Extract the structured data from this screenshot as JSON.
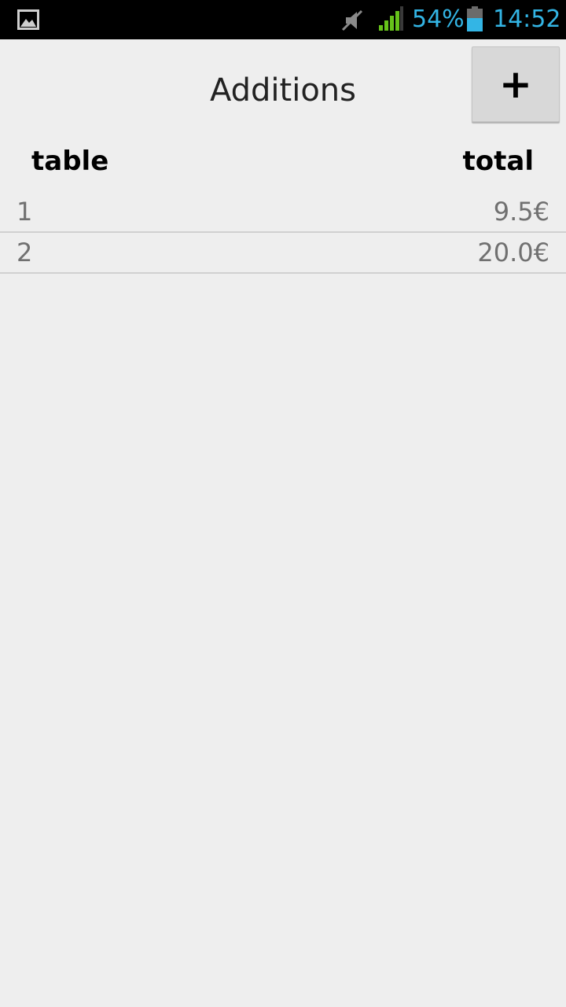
{
  "status_bar": {
    "battery_percent": "54%",
    "clock": "14:52",
    "icons": [
      "gallery-icon",
      "mute-icon",
      "signal-icon",
      "battery-icon"
    ],
    "accent_color": "#33b5e5"
  },
  "header": {
    "title": "Additions",
    "add_button_label": "+"
  },
  "columns": {
    "table": "table",
    "total": "total"
  },
  "rows": [
    {
      "table": "1",
      "total": "9.5€"
    },
    {
      "table": "2",
      "total": "20.0€"
    }
  ]
}
